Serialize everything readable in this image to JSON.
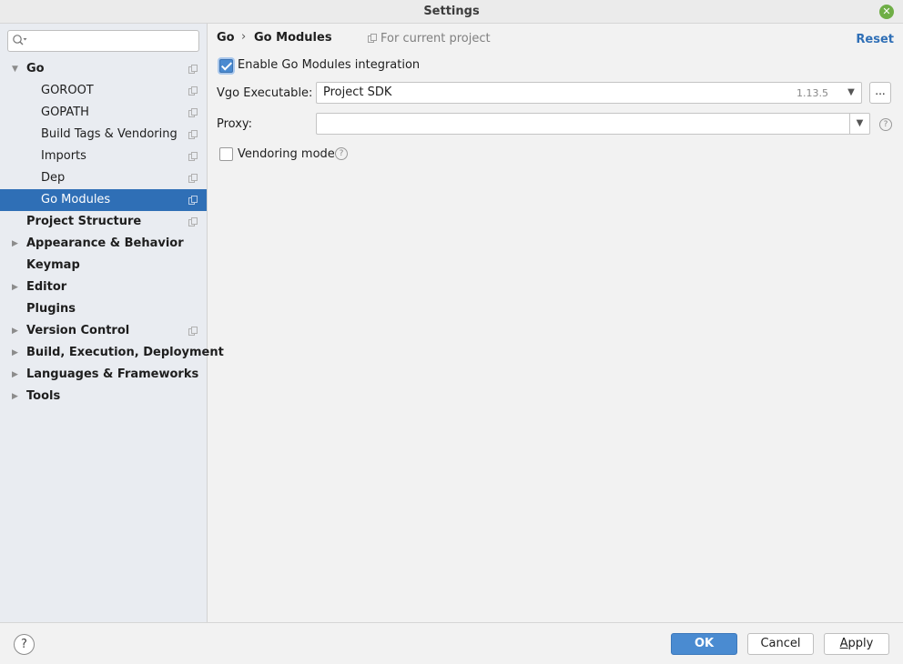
{
  "window": {
    "title": "Settings"
  },
  "search": {
    "placeholder": ""
  },
  "tree": [
    {
      "label": "Go",
      "bold": true,
      "arrow": "down",
      "project_icon": true,
      "indent": 0
    },
    {
      "label": "GOROOT",
      "bold": false,
      "arrow": "",
      "project_icon": true,
      "indent": 1
    },
    {
      "label": "GOPATH",
      "bold": false,
      "arrow": "",
      "project_icon": true,
      "indent": 1
    },
    {
      "label": "Build Tags & Vendoring",
      "bold": false,
      "arrow": "",
      "project_icon": true,
      "indent": 1
    },
    {
      "label": "Imports",
      "bold": false,
      "arrow": "",
      "project_icon": true,
      "indent": 1
    },
    {
      "label": "Dep",
      "bold": false,
      "arrow": "",
      "project_icon": true,
      "indent": 1
    },
    {
      "label": "Go Modules",
      "bold": false,
      "arrow": "",
      "project_icon": true,
      "indent": 1,
      "selected": true
    },
    {
      "label": "Project Structure",
      "bold": true,
      "arrow": "",
      "project_icon": true,
      "indent": 0
    },
    {
      "label": "Appearance & Behavior",
      "bold": true,
      "arrow": "right",
      "project_icon": false,
      "indent": 0
    },
    {
      "label": "Keymap",
      "bold": true,
      "arrow": "",
      "project_icon": false,
      "indent": 0
    },
    {
      "label": "Editor",
      "bold": true,
      "arrow": "right",
      "project_icon": false,
      "indent": 0
    },
    {
      "label": "Plugins",
      "bold": true,
      "arrow": "",
      "project_icon": false,
      "indent": 0
    },
    {
      "label": "Version Control",
      "bold": true,
      "arrow": "right",
      "project_icon": true,
      "indent": 0
    },
    {
      "label": "Build, Execution, Deployment",
      "bold": true,
      "arrow": "right",
      "project_icon": false,
      "indent": 0
    },
    {
      "label": "Languages & Frameworks",
      "bold": true,
      "arrow": "right",
      "project_icon": false,
      "indent": 0
    },
    {
      "label": "Tools",
      "bold": true,
      "arrow": "right",
      "project_icon": false,
      "indent": 0
    }
  ],
  "breadcrumb": {
    "parent": "Go",
    "current": "Go Modules",
    "scope": "For current project"
  },
  "reset_label": "Reset",
  "go_modules": {
    "enable_label": "Enable Go Modules integration",
    "enable_checked": true,
    "vgo_label": "Vgo Executable:",
    "vgo_value": "Project SDK",
    "vgo_version": "1.13.5",
    "browse_label": "...",
    "proxy_label": "Proxy:",
    "proxy_value": "",
    "vendoring_label": "Vendoring mode",
    "vendoring_checked": false
  },
  "footer": {
    "help": "?",
    "ok": "OK",
    "cancel": "Cancel",
    "apply": "Apply"
  }
}
